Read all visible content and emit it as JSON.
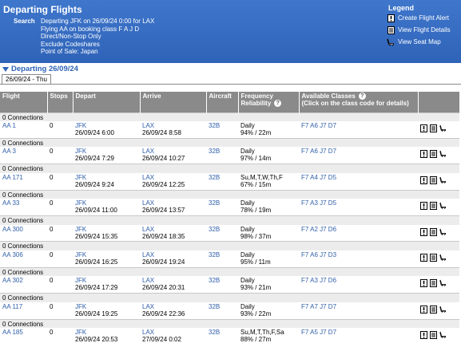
{
  "header": {
    "title": "Departing Flights",
    "search_label": "Search",
    "search_lines": [
      "Departing JFK on 26/09/24 0:00 for LAX",
      "Flying AA on booking class F A J D",
      "Direct/Non-Stop Only",
      "Exclude Codeshares",
      "Point of Sale: Japan"
    ]
  },
  "legend": {
    "title": "Legend",
    "items": [
      "Create Flight Alert",
      "View Flight Details",
      "View Seat Map"
    ]
  },
  "section": {
    "departing": "Departing 26/09/24",
    "tab": "26/09/24 - Thu"
  },
  "columns": {
    "flight": "Flight",
    "stops": "Stops",
    "depart": "Depart",
    "arrive": "Arrive",
    "aircraft": "Aircraft",
    "frequency": "Frequency",
    "reliability": "Reliability",
    "classes": "Available Classes",
    "classes_hint": "(Click on the class code for details)"
  },
  "flights": [
    {
      "conn": "0 Connections",
      "airline": "AA",
      "num": "1",
      "stops": "0",
      "from": "JFK",
      "dep": "26/09/24 6:00",
      "to": "LAX",
      "arr": "26/09/24 8:58",
      "aircraft": "32B",
      "freq": "Daily",
      "rel": "94% / 22m",
      "classes": "F7 A6 J7 D7"
    },
    {
      "conn": "0 Connections",
      "airline": "AA",
      "num": "3",
      "stops": "0",
      "from": "JFK",
      "dep": "26/09/24 7:29",
      "to": "LAX",
      "arr": "26/09/24 10:27",
      "aircraft": "32B",
      "freq": "Daily",
      "rel": "97% / 14m",
      "classes": "F7 A6 J7 D7"
    },
    {
      "conn": "0 Connections",
      "airline": "AA",
      "num": "171",
      "stops": "0",
      "from": "JFK",
      "dep": "26/09/24 9:24",
      "to": "LAX",
      "arr": "26/09/24 12:25",
      "aircraft": "32B",
      "freq": "Su,M,T,W,Th,F",
      "rel": "67% / 15m",
      "classes": "F7 A4 J7 D5"
    },
    {
      "conn": "0 Connections",
      "airline": "AA",
      "num": "33",
      "stops": "0",
      "from": "JFK",
      "dep": "26/09/24 11:00",
      "to": "LAX",
      "arr": "26/09/24 13:57",
      "aircraft": "32B",
      "freq": "Daily",
      "rel": "78% / 19m",
      "classes": "F7 A3 J7 D5"
    },
    {
      "conn": "0 Connections",
      "airline": "AA",
      "num": "300",
      "stops": "0",
      "from": "JFK",
      "dep": "26/09/24 15:35",
      "to": "LAX",
      "arr": "26/09/24 18:35",
      "aircraft": "32B",
      "freq": "Daily",
      "rel": "98% / 37m",
      "classes": "F7 A2 J7 D6"
    },
    {
      "conn": "0 Connections",
      "airline": "AA",
      "num": "306",
      "stops": "0",
      "from": "JFK",
      "dep": "26/09/24 16:25",
      "to": "LAX",
      "arr": "26/09/24 19:24",
      "aircraft": "32B",
      "freq": "Daily",
      "rel": "95% / 11m",
      "classes": "F7 A6 J7 D3"
    },
    {
      "conn": "0 Connections",
      "airline": "AA",
      "num": "302",
      "stops": "0",
      "from": "JFK",
      "dep": "26/09/24 17:29",
      "to": "LAX",
      "arr": "26/09/24 20:31",
      "aircraft": "32B",
      "freq": "Daily",
      "rel": "93% / 21m",
      "classes": "F7 A3 J7 D6"
    },
    {
      "conn": "0 Connections",
      "airline": "AA",
      "num": "117",
      "stops": "0",
      "from": "JFK",
      "dep": "26/09/24 19:25",
      "to": "LAX",
      "arr": "26/09/24 22:36",
      "aircraft": "32B",
      "freq": "Daily",
      "rel": "93% / 22m",
      "classes": "F7 A7 J7 D7"
    },
    {
      "conn": "0 Connections",
      "airline": "AA",
      "num": "185",
      "stops": "0",
      "from": "JFK",
      "dep": "26/09/24 20:53",
      "to": "LAX",
      "arr": "27/09/24 0:02",
      "aircraft": "32B",
      "freq": "Su,M,T,Th,F,Sa",
      "rel": "88% / 27m",
      "classes": "F7 A5 J7 D7"
    }
  ]
}
